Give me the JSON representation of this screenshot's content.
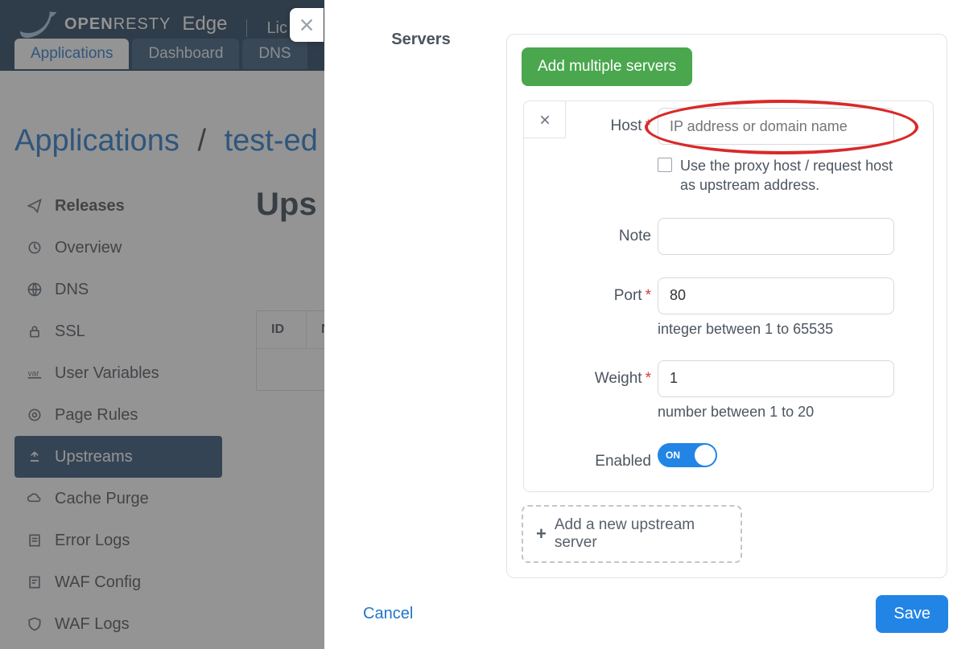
{
  "brand": {
    "name1": "OPEN",
    "name2": "RESTY",
    "edge": "Edge",
    "toplink": "Lic"
  },
  "tabs": {
    "applications": "Applications",
    "dashboard": "Dashboard",
    "dns": "DNS"
  },
  "breadcrumb": {
    "root": "Applications",
    "last": "test-ed",
    "sep": "/"
  },
  "sidebar": {
    "items": [
      {
        "label": "Releases"
      },
      {
        "label": "Overview"
      },
      {
        "label": "DNS"
      },
      {
        "label": "SSL"
      },
      {
        "label": "User Variables"
      },
      {
        "label": "Page Rules"
      },
      {
        "label": "Upstreams"
      },
      {
        "label": "Cache Purge"
      },
      {
        "label": "Error Logs"
      },
      {
        "label": "WAF Config"
      },
      {
        "label": "WAF Logs"
      }
    ]
  },
  "content": {
    "title": "Ups"
  },
  "table": {
    "col_id": "ID",
    "col_name": "N"
  },
  "panel": {
    "section_label": "Servers",
    "add_multi": "Add multiple servers",
    "host_label": "Host",
    "host_placeholder": "IP address or domain name",
    "proxy_check": "Use the proxy host / request host as upstream address.",
    "note_label": "Note",
    "port_label": "Port",
    "port_value": "80",
    "port_hint": "integer between 1 to 65535",
    "weight_label": "Weight",
    "weight_value": "1",
    "weight_hint": "number between 1 to 20",
    "enabled_label": "Enabled",
    "enabled_text": "ON",
    "add_server": "Add a new upstream server",
    "cancel": "Cancel",
    "save": "Save"
  }
}
